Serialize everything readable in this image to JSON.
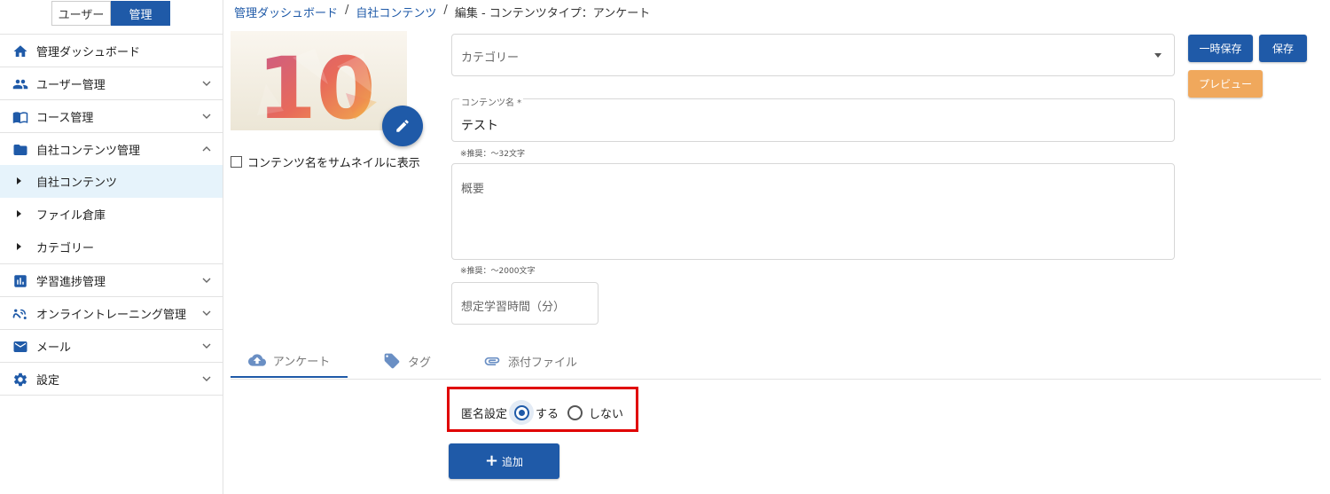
{
  "role_switch": {
    "user": "ユーザー",
    "admin": "管理",
    "active": "admin"
  },
  "sidebar": {
    "items": [
      {
        "label": "管理ダッシュボード",
        "icon": "home-icon"
      },
      {
        "label": "ユーザー管理",
        "icon": "users-icon"
      },
      {
        "label": "コース管理",
        "icon": "book-icon"
      },
      {
        "label": "自社コンテンツ管理",
        "icon": "folder-icon"
      },
      {
        "label": "自社コンテンツ",
        "icon": "caret-right-icon"
      },
      {
        "label": "ファイル倉庫",
        "icon": "caret-right-icon"
      },
      {
        "label": "カテゴリー",
        "icon": "caret-right-icon"
      },
      {
        "label": "学習進捗管理",
        "icon": "bar-chart-icon"
      },
      {
        "label": "オンライントレーニング管理",
        "icon": "training-icon"
      },
      {
        "label": "メール",
        "icon": "mail-icon"
      },
      {
        "label": "設定",
        "icon": "gear-icon"
      }
    ]
  },
  "breadcrumb": {
    "items": [
      "管理ダッシュボード",
      "自社コンテンツ"
    ],
    "separator": "/",
    "current": "編集 - コンテンツタイプ：アンケート"
  },
  "thumbnail": {
    "number": "10",
    "checkbox_label": "コンテンツ名をサムネイルに表示"
  },
  "form": {
    "category_placeholder": "カテゴリー",
    "content_name_label": "コンテンツ名 *",
    "content_name_value": "テスト",
    "content_name_hint": "※推奨：～32文字",
    "summary_placeholder": "概要",
    "summary_hint": "※推奨：～2000文字",
    "study_time_placeholder": "想定学習時間（分）"
  },
  "actions": {
    "temp_save": "一時保存",
    "save": "保存",
    "preview": "プレビュー"
  },
  "tabs": [
    {
      "label": "アンケート",
      "icon": "cloud-upload-icon"
    },
    {
      "label": "タグ",
      "icon": "tag-icon"
    },
    {
      "label": "添付ファイル",
      "icon": "paperclip-icon"
    }
  ],
  "anonymous": {
    "label": "匿名設定",
    "yes": "する",
    "no": "しない",
    "selected": "yes"
  },
  "add_button": {
    "label": "追加"
  },
  "colors": {
    "primary": "#1f5aa8",
    "preview": "#f0a85c",
    "highlight": "#e00000",
    "selected_nav": "#e6f3fb"
  }
}
